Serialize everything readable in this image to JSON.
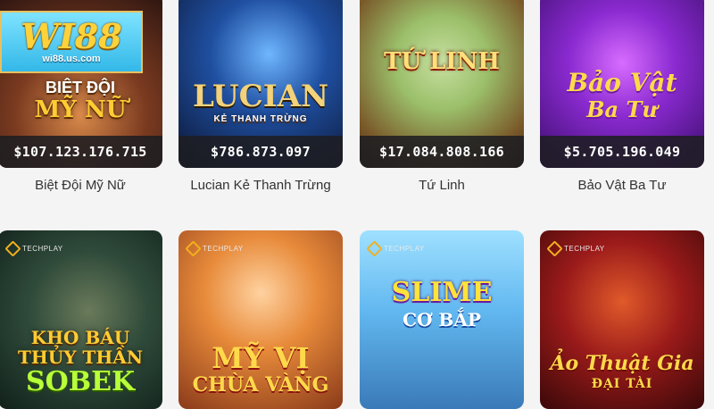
{
  "logo": {
    "brand": "WI88",
    "url": "wi88.us.com"
  },
  "games": [
    {
      "name": "Biệt Đội Mỹ Nữ",
      "jackpot": "$107.123.176.715",
      "art_title_1": "BIỆT ĐỘI",
      "art_title_2": "MỸ NỮ"
    },
    {
      "name": "Lucian Kẻ Thanh Trừng",
      "jackpot": "$786.873.097",
      "art_title_1": "LUCIAN",
      "art_title_2": "KẺ THANH TRỪNG"
    },
    {
      "name": "Tứ Linh",
      "jackpot": "$17.084.808.166",
      "art_title_1": "TỨ LINH"
    },
    {
      "name": "Bảo Vật Ba Tư",
      "jackpot": "$5.705.196.049",
      "art_title_1": "Bảo Vật",
      "art_title_2": "Ba Tư"
    },
    {
      "provider": "TECHPLAY",
      "art_title_1": "KHO BÁU",
      "art_title_2": "THỦY THẦN",
      "art_title_3": "SOBEK"
    },
    {
      "provider": "TECHPLAY",
      "art_title_1": "MỸ VỊ",
      "art_title_2": "CHÙA VÀNG"
    },
    {
      "provider": "TECHPLAY",
      "art_title_1": "SLIME",
      "art_title_2": "CƠ BẮP"
    },
    {
      "provider": "TECHPLAY",
      "art_title_1": "Ảo Thuật Gia",
      "art_title_2": "ĐẠI TÀI"
    }
  ]
}
